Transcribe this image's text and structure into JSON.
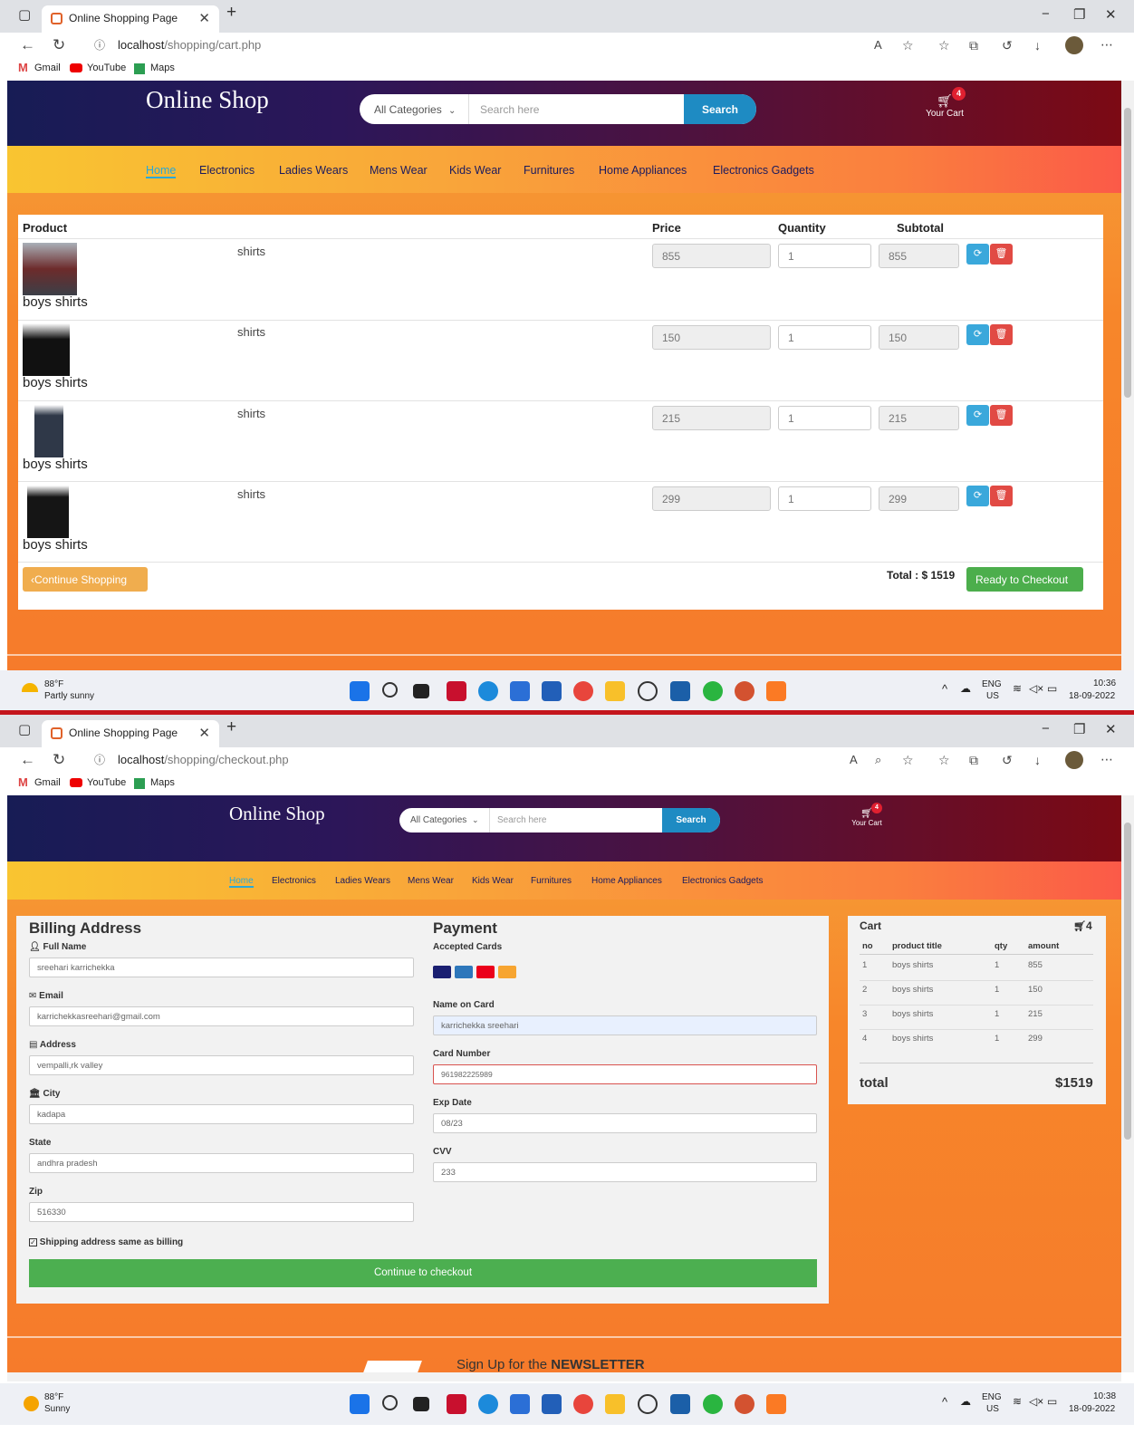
{
  "browser": {
    "tab_title": "Online Shopping Page",
    "bookmarks": [
      "Gmail",
      "YouTube",
      "Maps"
    ]
  },
  "screen1": {
    "url_domain": "localhost",
    "url_path": "/shopping/cart.php",
    "site": {
      "logo": "Online Shop",
      "category_select": "All Categories",
      "search_placeholder": "Search here",
      "search_button": "Search",
      "cart_label": "Your Cart",
      "cart_count": "4",
      "menu": [
        "Home",
        "Electronics",
        "Ladies Wears",
        "Mens Wear",
        "Kids Wear",
        "Furnitures",
        "Home Appliances",
        "Electronics Gadgets"
      ]
    },
    "cart_table": {
      "headers": {
        "product": "Product",
        "price": "Price",
        "quantity": "Quantity",
        "subtotal": "Subtotal"
      },
      "rows": [
        {
          "name": "boys shirts",
          "desc": "shirts",
          "price": "855",
          "qty": "1",
          "subtotal": "855"
        },
        {
          "name": "boys shirts",
          "desc": "shirts",
          "price": "150",
          "qty": "1",
          "subtotal": "150"
        },
        {
          "name": "boys shirts",
          "desc": "shirts",
          "price": "215",
          "qty": "1",
          "subtotal": "215"
        },
        {
          "name": "boys shirts",
          "desc": "shirts",
          "price": "299",
          "qty": "1",
          "subtotal": "299"
        }
      ],
      "continue_button": "‹Continue Shopping",
      "total": "Total : $ 1519",
      "checkout_button": "Ready to Checkout"
    },
    "taskbar": {
      "temp": "88°F",
      "weather": "Partly sunny",
      "lang": "ENG",
      "region": "US",
      "time": "10:36",
      "date": "18-09-2022"
    }
  },
  "screen2": {
    "url_domain": "localhost",
    "url_path": "/shopping/checkout.php",
    "billing": {
      "title": "Billing Address",
      "full_name_label": "Full Name",
      "full_name": "sreehari karrichekka",
      "email_label": "Email",
      "email": "karrichekkasreehari@gmail.com",
      "address_label": "Address",
      "address": "vempalli,rk valley",
      "city_label": "City",
      "city": "kadapa",
      "state_label": "State",
      "state": "andhra pradesh",
      "zip_label": "Zip",
      "zip": "516330",
      "same_label": "Shipping address same as billing",
      "continue_button": "Continue to checkout"
    },
    "payment": {
      "title": "Payment",
      "accepted_label": "Accepted Cards",
      "name_label": "Name on Card",
      "name": "karrichekka sreehari",
      "card_label": "Card Number",
      "card": "961982225989",
      "exp_label": "Exp Date",
      "exp": "08/23",
      "cvv_label": "CVV",
      "cvv": "233"
    },
    "cart_summary": {
      "title": "Cart",
      "count": "4",
      "headers": [
        "no",
        "product title",
        "qty",
        "amount"
      ],
      "rows": [
        [
          "1",
          "boys shirts",
          "1",
          "855"
        ],
        [
          "2",
          "boys shirts",
          "1",
          "150"
        ],
        [
          "3",
          "boys shirts",
          "1",
          "215"
        ],
        [
          "4",
          "boys shirts",
          "1",
          "299"
        ]
      ],
      "total_label": "total",
      "total_value": "$1519"
    },
    "newsletter_prefix": "Sign Up for the",
    "newsletter_bold": "NEWSLETTER",
    "taskbar": {
      "temp": "88°F",
      "weather": "Sunny",
      "lang": "ENG",
      "region": "US",
      "time": "10:38",
      "date": "18-09-2022"
    }
  }
}
